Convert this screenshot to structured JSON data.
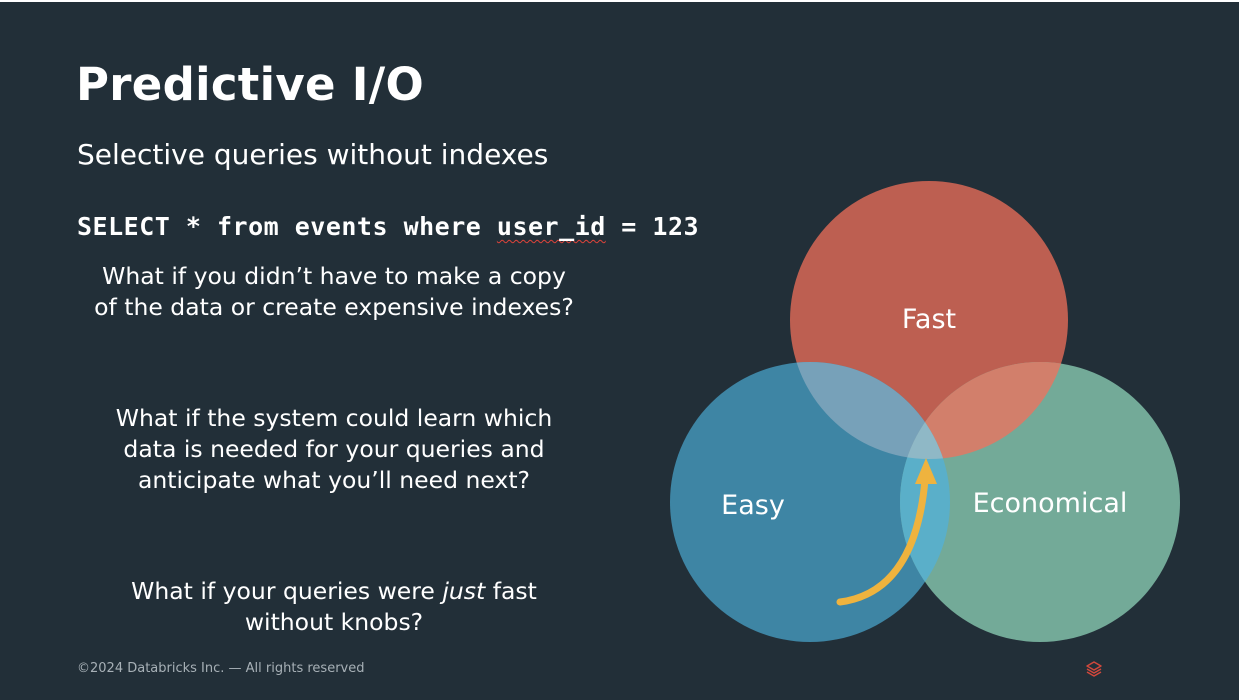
{
  "slide": {
    "title": "Predictive I/O",
    "subtitle": "Selective queries without indexes",
    "sql": {
      "before": "SELECT * from events where ",
      "flagged_word": "user_id",
      "after": " = 123"
    },
    "questions": {
      "q1": "What if you didn’t have to make a copy of the data or create expensive indexes?",
      "q2": "What if the system could learn which data is needed for your queries and anticipate what you’ll need next?",
      "q3_before": "What if your queries were ",
      "q3_emphasis": "just",
      "q3_after": " fast without knobs?"
    },
    "footer": "©2024 Databricks Inc. — All rights reserved",
    "logo_icon": "databricks-logo-icon"
  },
  "venn": {
    "labels": {
      "top": "Fast",
      "left": "Easy",
      "right": "Economical"
    },
    "colors": {
      "fast": "#bd5f51",
      "easy": "#3e85a4",
      "economical": "#73aa98",
      "arrow": "#efb33e",
      "background": "#222f38"
    }
  }
}
